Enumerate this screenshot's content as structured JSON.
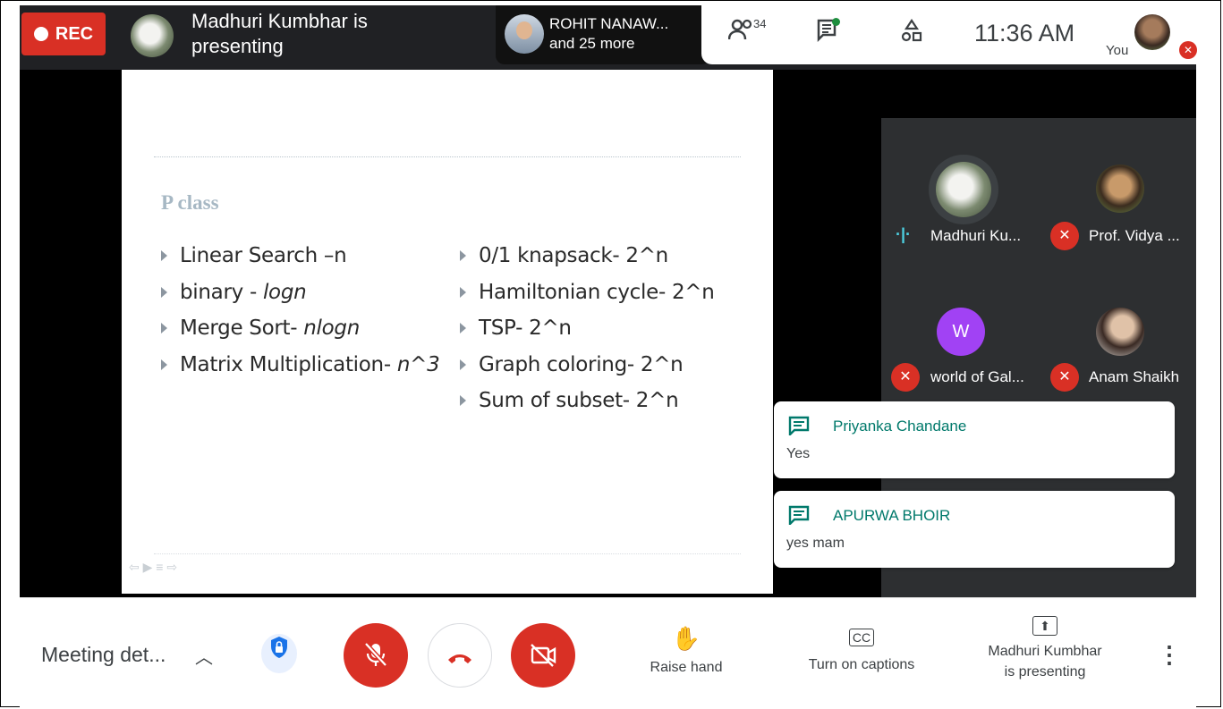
{
  "top_bar": {
    "rec_label": "REC",
    "presenter_line1": "Madhuri Kumbhar is",
    "presenter_line2": "presenting",
    "people_line1": "ROHIT NANAW...",
    "people_line2": "and 25 more",
    "participant_count": "34",
    "time": "11:36 AM",
    "self_label": "You",
    "icons": [
      "people-icon",
      "chat-icon",
      "activities-icon"
    ]
  },
  "slide": {
    "heading": "P class",
    "left_items": [
      {
        "pre": "Linear Search –n",
        "italic": ""
      },
      {
        "pre": "binary - ",
        "italic": "logn"
      },
      {
        "pre": "Merge Sort- ",
        "italic": "nlogn"
      },
      {
        "pre": "Matrix Multiplication- ",
        "italic": "n^3"
      }
    ],
    "right_items": [
      "0/1 knapsack- 2^n",
      "Hamiltonian cycle- 2^n",
      "TSP- 2^n",
      "Graph coloring- 2^n",
      "Sum of subset- 2^n"
    ]
  },
  "participants": [
    {
      "name": "Madhuri Ku...",
      "speaking": true,
      "avatar_color": "#6f7d66"
    },
    {
      "name": "Prof. Vidya ...",
      "muted": true,
      "avatar_color": "#b27a4a"
    },
    {
      "name": "world of Gal...",
      "muted": true,
      "avatar_letter": "W",
      "avatar_color": "#a142f4"
    },
    {
      "name": "Anam Shaikh",
      "muted": true,
      "avatar_color": "#8d6f63"
    }
  ],
  "chat": [
    {
      "sender": "Priyanka Chandane",
      "message": "Yes"
    },
    {
      "sender": "APURWA BHOIR",
      "message": "yes mam"
    }
  ],
  "bottom_bar": {
    "meeting_details": "Meeting det...",
    "raise_hand": "Raise hand",
    "captions": "Turn on captions",
    "presenting_line1": "Madhuri Kumbhar",
    "presenting_line2": "is presenting"
  },
  "colors": {
    "red": "#d93025",
    "accent_teal": "#00796b",
    "bar_dark": "#202124"
  }
}
